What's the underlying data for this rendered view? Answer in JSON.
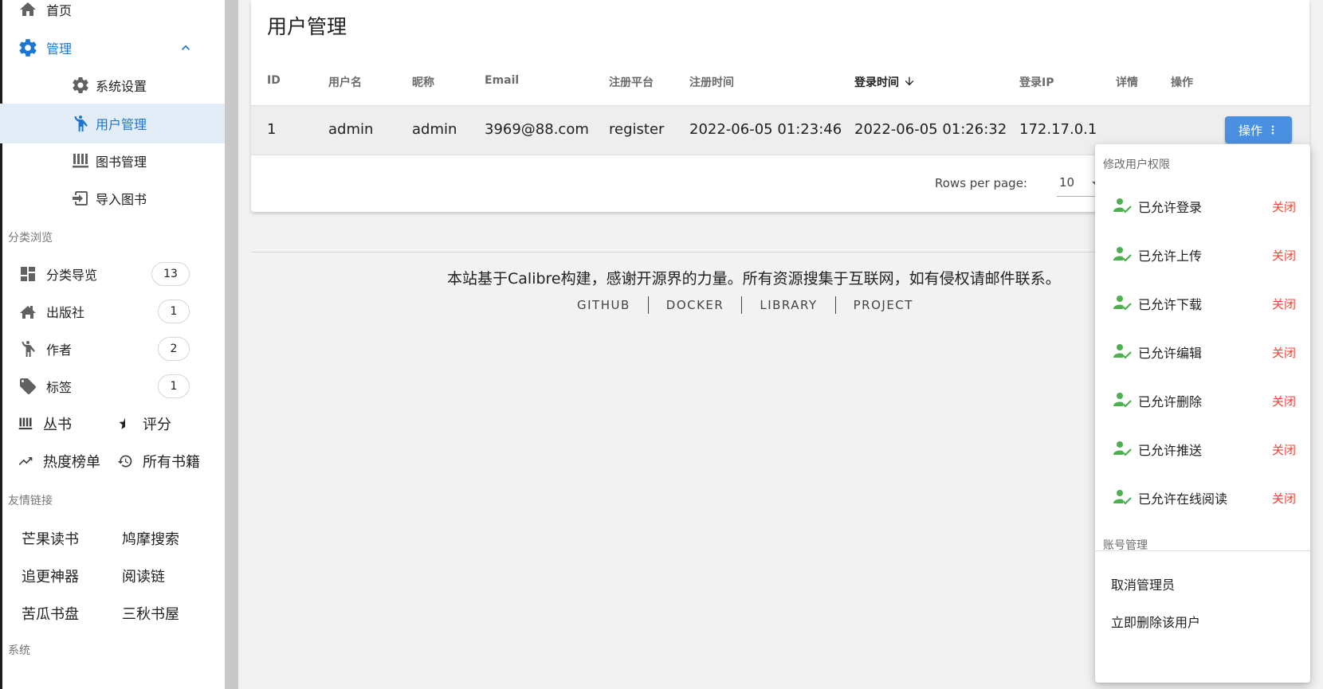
{
  "sidebar": {
    "home": "首页",
    "admin": "管理",
    "admin_children": [
      "系统设置",
      "用户管理",
      "图书管理",
      "导入图书"
    ],
    "browse_header": "分类浏览",
    "browse_items": [
      {
        "label": "分类导览",
        "count": "13"
      },
      {
        "label": "出版社",
        "count": "1"
      },
      {
        "label": "作者",
        "count": "2"
      },
      {
        "label": "标签",
        "count": "1"
      }
    ],
    "grid_items": [
      "丛书",
      "评分",
      "热度榜单",
      "所有书籍"
    ],
    "links_header": "友情链接",
    "links": [
      "芒果读书",
      "鸠摩搜索",
      "追更神器",
      "阅读链",
      "苦瓜书盘",
      "三秋书屋"
    ],
    "system_header": "系统"
  },
  "main": {
    "title": "用户管理",
    "columns": [
      "ID",
      "用户名",
      "昵称",
      "Email",
      "注册平台",
      "注册时间",
      "登录时间",
      "登录IP",
      "详情",
      "操作"
    ],
    "rows": [
      {
        "id": "1",
        "username": "admin",
        "nickname": "admin",
        "email": "3969@88.com",
        "platform": "register",
        "reg_time": "2022-06-05 01:23:46",
        "login_time": "2022-06-05 01:26:32",
        "login_ip": "172.17.0.1",
        "action": "操作"
      }
    ],
    "rows_per_page_label": "Rows per page:",
    "rows_per_page_value": "10"
  },
  "footer": {
    "text": "本站基于Calibre构建，感谢开源界的力量。所有资源搜集于互联网，如有侵权请邮件联系。",
    "links": [
      "GITHUB",
      "DOCKER",
      "LIBRARY",
      "PROJECT"
    ]
  },
  "menu": {
    "permissions_header": "修改用户权限",
    "permissions": [
      {
        "label": "已允许登录",
        "action": "关闭"
      },
      {
        "label": "已允许上传",
        "action": "关闭"
      },
      {
        "label": "已允许下载",
        "action": "关闭"
      },
      {
        "label": "已允许编辑",
        "action": "关闭"
      },
      {
        "label": "已允许删除",
        "action": "关闭"
      },
      {
        "label": "已允许推送",
        "action": "关闭"
      },
      {
        "label": "已允许在线阅读",
        "action": "关闭"
      }
    ],
    "account_header": "账号管理",
    "account_items": [
      "取消管理员",
      "立即删除该用户"
    ]
  },
  "colors": {
    "primary": "#1976d2",
    "button": "#4a90e2",
    "danger": "#f44336",
    "success": "#4caf50",
    "active_bg": "#e3edf8"
  },
  "icons": {
    "home": "home-icon",
    "admin": "gear-icon",
    "settings": "gear-icon",
    "users": "person-icon",
    "books": "library-icon",
    "import": "import-icon",
    "categories": "dashboard-icon",
    "publisher": "house-people-icon",
    "author": "person-walk-icon",
    "tags": "tag-icon",
    "series": "library-icon",
    "rating": "star-half-icon",
    "hot": "trending-up-icon",
    "all_books": "history-icon",
    "permission": "person-check-icon",
    "more": "more-vertical-icon"
  }
}
